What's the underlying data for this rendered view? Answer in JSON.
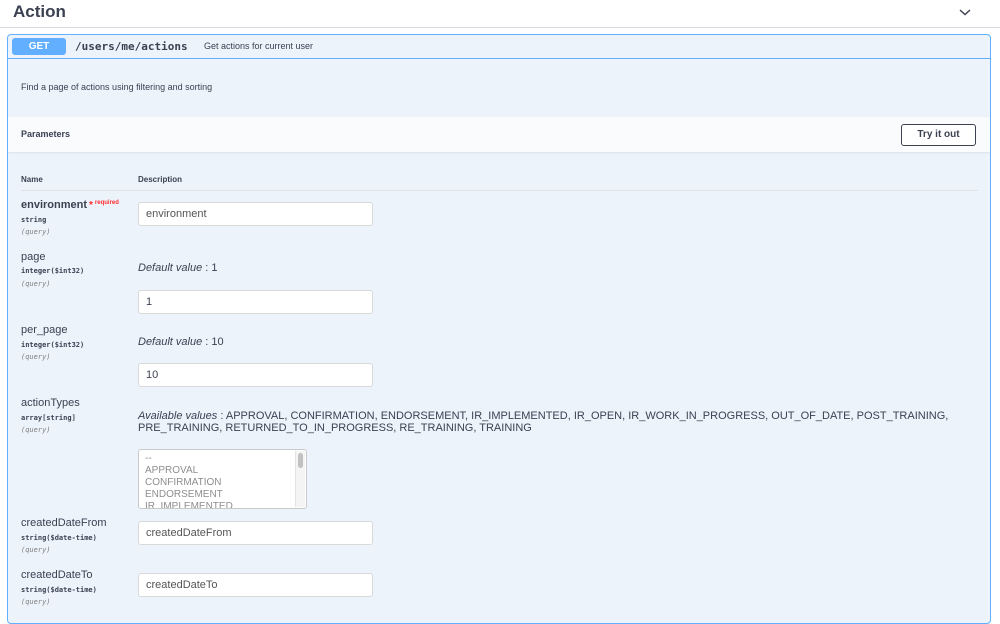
{
  "section": {
    "title": "Action",
    "chevron_icon": "chevron-down-icon"
  },
  "operation": {
    "method": "GET",
    "path": "/users/me/actions",
    "summary": "Get actions for current user",
    "description": "Find a page of actions using filtering and sorting",
    "method_color": "#61affe"
  },
  "parameters": {
    "title": "Parameters",
    "try_button": "Try it out",
    "columns": {
      "name": "Name",
      "description": "Description"
    },
    "environment": {
      "name": "environment",
      "required_star": "*",
      "required_label": "required",
      "type": "string",
      "in": "(query)",
      "placeholder": "environment"
    },
    "page": {
      "name": "page",
      "type": "integer($int32)",
      "in": "(query)",
      "default_label": "Default value",
      "default_sep": " : 1",
      "value": "1"
    },
    "per_page": {
      "name": "per_page",
      "type": "integer($int32)",
      "in": "(query)",
      "default_label": "Default value",
      "default_sep": " : 10",
      "value": "10"
    },
    "actionTypes": {
      "name": "actionTypes",
      "type": "array[string]",
      "in": "(query)",
      "available_label": "Available values",
      "available_values": " : APPROVAL, CONFIRMATION, ENDORSEMENT, IR_IMPLEMENTED, IR_OPEN, IR_WORK_IN_PROGRESS, OUT_OF_DATE, POST_TRAINING, PRE_TRAINING, RETURNED_TO_IN_PROGRESS, RE_TRAINING, TRAINING",
      "options": [
        "--",
        "APPROVAL",
        "CONFIRMATION",
        "ENDORSEMENT",
        "IR_IMPLEMENTED"
      ]
    },
    "createdDateFrom": {
      "name": "createdDateFrom",
      "type": "string($date-time)",
      "in": "(query)",
      "placeholder": "createdDateFrom"
    },
    "createdDateTo": {
      "name": "createdDateTo",
      "type": "string($date-time)",
      "in": "(query)",
      "placeholder": "createdDateTo"
    }
  }
}
